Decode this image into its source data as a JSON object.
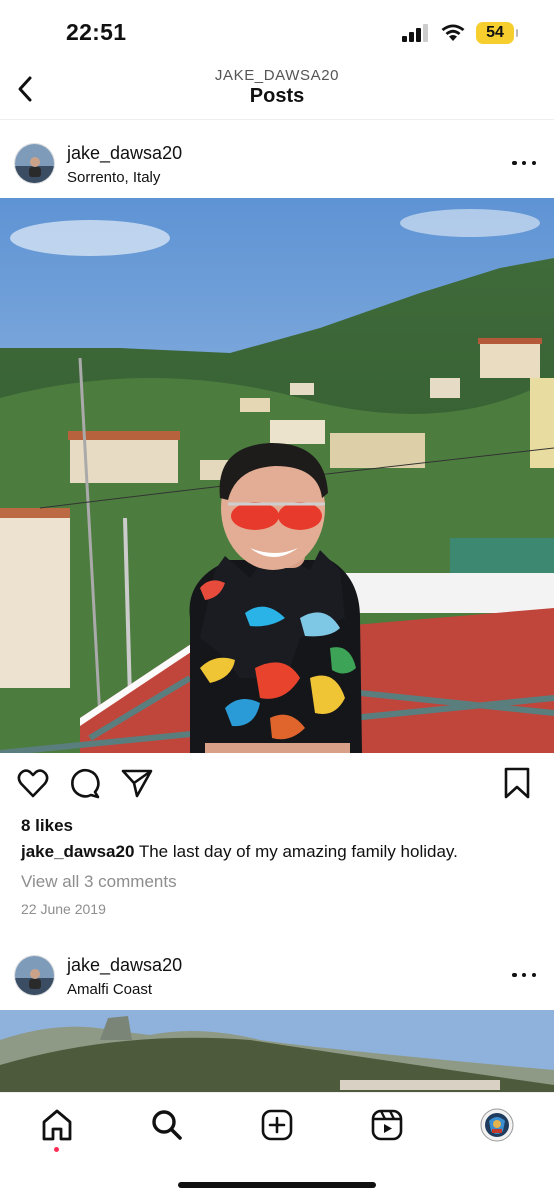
{
  "status": {
    "time": "22:51",
    "battery": "54"
  },
  "header": {
    "account": "JAKE_DAWSA20",
    "title": "Posts"
  },
  "posts": [
    {
      "username": "jake_dawsa20",
      "location": "Sorrento, Italy",
      "likes": "8 likes",
      "caption_user": "jake_dawsa20",
      "caption_text": "The last day of my amazing family holiday.",
      "comments_link": "View all 3 comments",
      "date": "22 June 2019"
    },
    {
      "username": "jake_dawsa20",
      "location": "Amalfi Coast"
    }
  ],
  "icons": {
    "back": "chevron-left-icon",
    "more": "more-dots-icon",
    "like": "heart-icon",
    "comment": "comment-bubble-icon",
    "share": "paper-plane-icon",
    "save": "bookmark-icon",
    "home": "home-icon",
    "search": "search-icon",
    "create": "plus-square-icon",
    "reels": "reels-icon",
    "profile": "profile-avatar"
  },
  "colors": {
    "battery": "#f6cf2e",
    "notification_dot": "#ff2d55",
    "secondary_text": "#8e8e8e"
  }
}
